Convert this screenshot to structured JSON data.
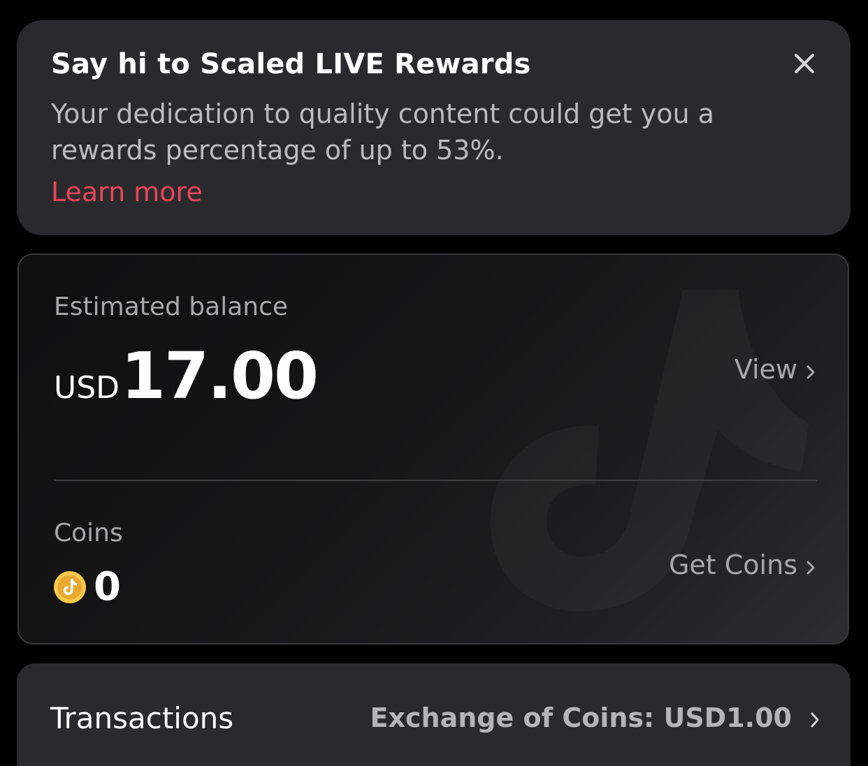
{
  "promo": {
    "title": "Say hi to Scaled LIVE Rewards",
    "body": "Your dedication to quality content could get you a rewards percentage of up to 53%.",
    "link": "Learn more",
    "close_icon": "close-icon"
  },
  "balance": {
    "label": "Estimated balance",
    "currency": "USD",
    "amount": "17.00",
    "view_label": "View",
    "coins_label": "Coins",
    "coins_value": "0",
    "get_coins_label": "Get Coins",
    "coin_icon": "tiktok-coin-icon"
  },
  "transactions": {
    "label": "Transactions",
    "exchange_text": "Exchange of Coins: USD1.00"
  },
  "colors": {
    "background": "#000000",
    "card": "#2a2a2c",
    "accent_link": "#ea445a",
    "muted_text": "#a8a8aa",
    "coin": "#f2b233"
  }
}
